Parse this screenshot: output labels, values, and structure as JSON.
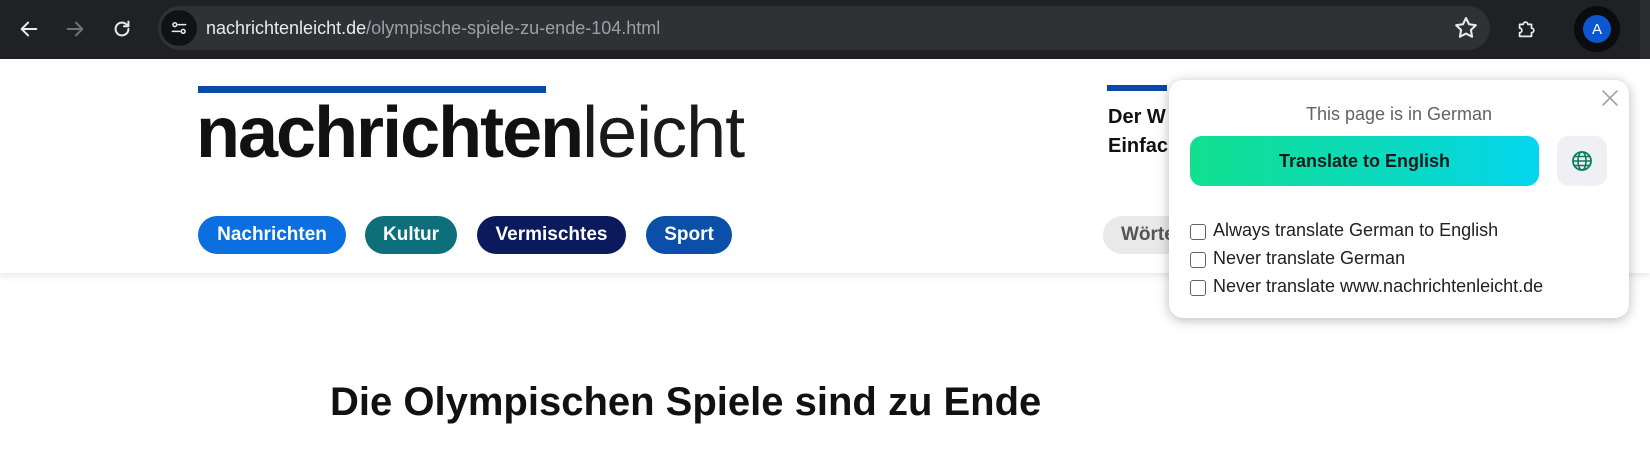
{
  "browser": {
    "url_host": "nachrichtenleicht.de",
    "url_path": "/olympische-spiele-zu-ende-104.html",
    "profile_initial": "A",
    "icons": [
      "back-arrow-icon",
      "forward-arrow-icon",
      "reload-icon",
      "site-info-icon",
      "bookmark-star-icon",
      "extensions-puzzle-icon"
    ]
  },
  "site": {
    "logo_bold": "nachrichten",
    "logo_light": "leicht",
    "nav": [
      {
        "label": "Nachrichten",
        "color": "#0b6fe0"
      },
      {
        "label": "Kultur",
        "color": "#0d6f7a"
      },
      {
        "label": "Vermischtes",
        "color": "#0a1a5c"
      },
      {
        "label": "Sport",
        "color": "#0b4fa8"
      }
    ],
    "side_title_line1": "Der W",
    "side_title_line2": "Einfac",
    "woerter_label": "Wörte",
    "headline": "Die Olympischen Spiele sind zu Ende"
  },
  "translate_popup": {
    "title": "This page is in German",
    "translate_button": "Translate to English",
    "options": [
      {
        "label": "Always translate German to English",
        "checked": false
      },
      {
        "label": "Never translate German",
        "checked": false
      },
      {
        "label": "Never translate www.nachrichtenleicht.de",
        "checked": false
      }
    ],
    "accent_gradient": [
      "#12e08f",
      "#04d6ef"
    ]
  }
}
